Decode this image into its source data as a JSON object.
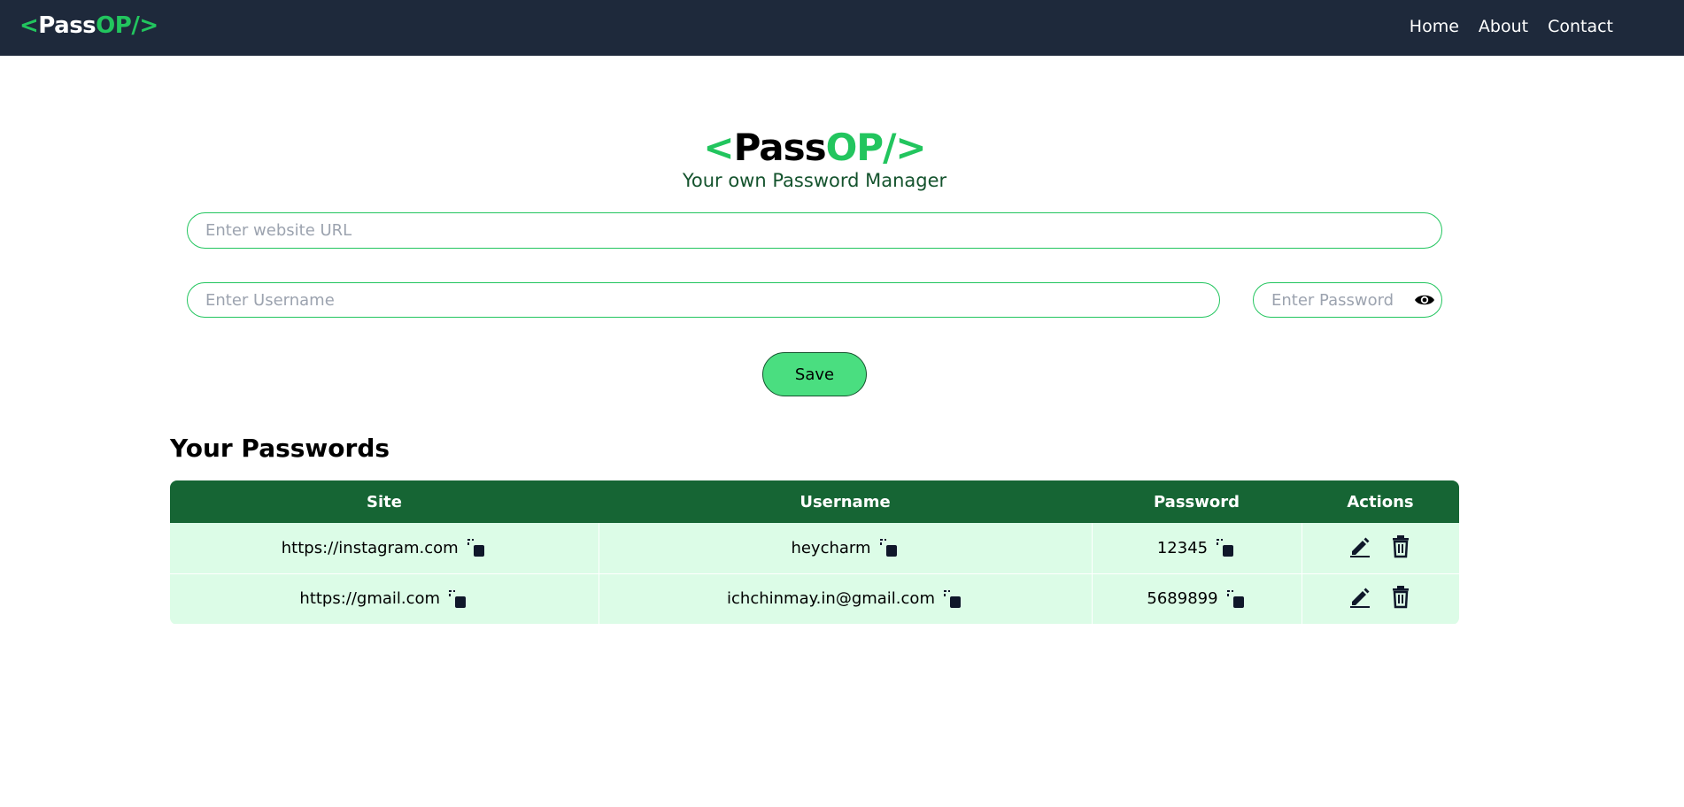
{
  "navbar": {
    "logo": {
      "open": "<",
      "main": "Pass",
      "accent": "OP/",
      "close": ">"
    },
    "links": [
      "Home",
      "About",
      "Contact"
    ],
    "bg_color": "#1e293b"
  },
  "hero": {
    "logo": {
      "open": "<",
      "main": "Pass",
      "accent": "OP/",
      "close": ">"
    },
    "tagline": "Your own Password Manager"
  },
  "form": {
    "url_placeholder": "Enter website URL",
    "username_placeholder": "Enter Username",
    "password_placeholder": "Enter Password",
    "save_label": "Save",
    "show_password_icon": "eye-icon"
  },
  "passwords": {
    "title": "Your Passwords",
    "headers": [
      "Site",
      "Username",
      "Password",
      "Actions"
    ],
    "rows": [
      {
        "site": "https://instagram.com",
        "username": "heycharm",
        "password": "12345"
      },
      {
        "site": "https://gmail.com",
        "username": "ichchinmay.in@gmail.com",
        "password": "5689899"
      }
    ],
    "icons": {
      "copy": "copy-icon",
      "edit": "edit-icon",
      "delete": "trash-icon"
    }
  },
  "colors": {
    "accent": "#22c55e",
    "button": "#4ade80",
    "table_header": "#166534",
    "table_row": "#dcfce7",
    "tagline": "#14532d"
  }
}
